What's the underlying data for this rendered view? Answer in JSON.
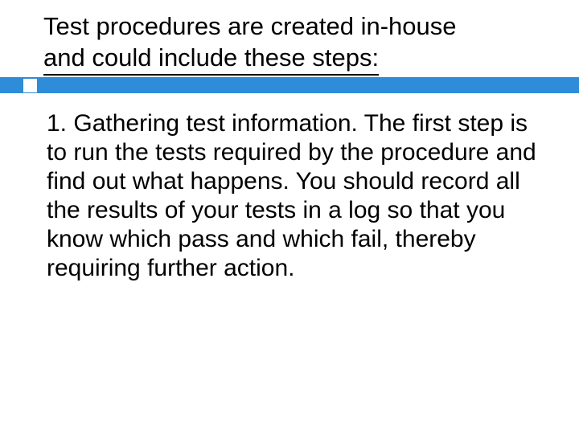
{
  "slide": {
    "title_line1": "Test procedures are created in-house",
    "title_line2": "and could include these steps:",
    "accent_color": "#2e8cd8",
    "body": "1. Gathering test information. The first step is to run the tests required by the procedure and find out what happens. You should record all the results of your tests  in a log so that you know which pass and which fail, thereby requiring further action."
  }
}
